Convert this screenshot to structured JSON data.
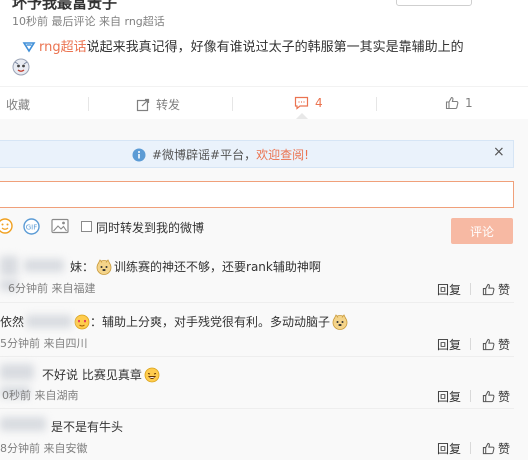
{
  "post": {
    "author_name": "坏予我最富贵子",
    "time": "10秒前",
    "latest_comment": "最后评论",
    "source_prefix": "来自",
    "source": "rng超话",
    "topic": "rng超话",
    "text": "说起来我真记得，好像有谁说过太子的韩服第一其实是靠辅助上的"
  },
  "actions": {
    "favorite": "收藏",
    "repost": "转发",
    "comment_count": "4",
    "like_count": "1"
  },
  "notice": {
    "text": "#微博辟谣#平台，",
    "link": "欢迎查阅!",
    "close": "×"
  },
  "composer": {
    "input_value": "",
    "forward_label": "同时转发到我的微博",
    "submit": "评论"
  },
  "comments": [
    {
      "user_visible": "妹：",
      "text": "训练赛的神还不够，还要rank辅助神啊",
      "time": "6分钟前",
      "source": "来自福建",
      "reply": "回复",
      "like": "赞"
    },
    {
      "user_visible": "依然",
      "text": "：辅助上分爽，对手残党很有利。多动动脑子",
      "time": "5分钟前",
      "source": "来自四川",
      "reply": "回复",
      "like": "赞"
    },
    {
      "user_visible": "",
      "text": "不好说 比赛见真章",
      "time": "0秒前",
      "source": "来自湖南",
      "reply": "回复",
      "like": "赞"
    },
    {
      "user_visible": "",
      "text": "是不是有牛头",
      "time": "8分钟前",
      "source": "来自安徽",
      "reply": "回复",
      "like": "赞"
    }
  ],
  "colors": {
    "accent": "#eb7350",
    "notice_bg": "#eaf2fb",
    "submit_disabled": "#f7b9a3"
  }
}
